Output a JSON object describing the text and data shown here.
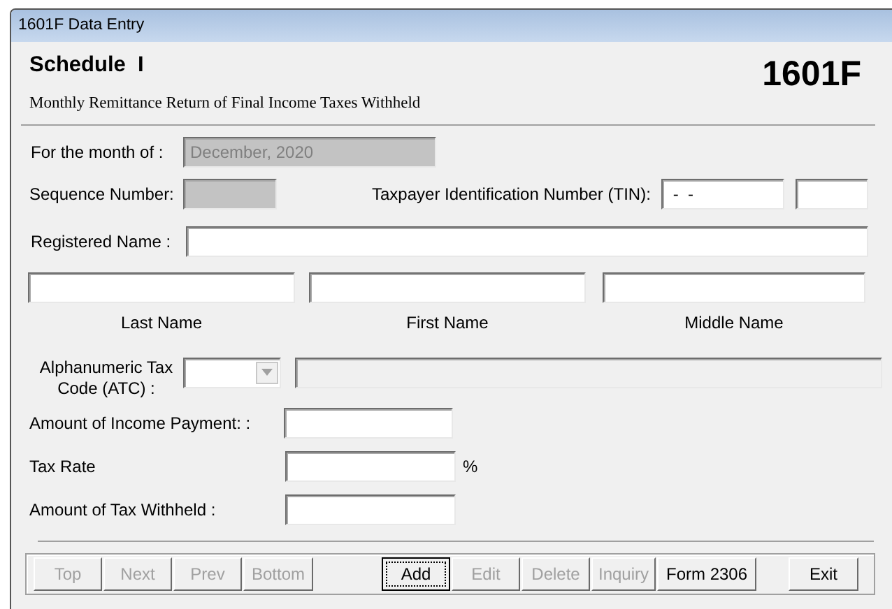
{
  "window": {
    "title": "1601F Data Entry"
  },
  "header": {
    "schedule": "Schedule  I",
    "form_number": "1601F",
    "subtitle": "Monthly Remittance Return of Final Income Taxes Withheld"
  },
  "month": {
    "label": "For the month of :",
    "value": "December, 2020",
    "disabled": true
  },
  "sequence": {
    "label": "Sequence Number:",
    "disabled": true
  },
  "tin": {
    "label": "Taxpayer Identification Number (TIN):",
    "value": " -  -",
    "disabled": false
  },
  "registered_name": {
    "label": "Registered Name :",
    "disabled": false
  },
  "name_fields": [
    {
      "label": "Last Name",
      "disabled": false
    },
    {
      "label": "First Name",
      "disabled": false
    },
    {
      "label": "Middle Name",
      "disabled": false
    }
  ],
  "atc": {
    "label": "Alphanumeric Tax Code (ATC) :",
    "disabled": false,
    "description_disabled": true
  },
  "amounts": [
    {
      "label": "Amount of Income Payment: :",
      "disabled": false
    },
    {
      "label": "Tax Rate",
      "unit": "%",
      "disabled": false
    },
    {
      "label": "Amount of Tax Withheld :",
      "disabled": false
    }
  ],
  "navigation_buttons": [
    {
      "label": "Top",
      "disabled": true,
      "focused": false
    },
    {
      "label": "Next",
      "disabled": true,
      "focused": false
    },
    {
      "label": "Prev",
      "disabled": true,
      "focused": false
    },
    {
      "label": "Bottom",
      "disabled": true,
      "focused": false
    }
  ],
  "record_buttons": [
    {
      "label": "Add",
      "disabled": false,
      "focused": true
    },
    {
      "label": "Edit",
      "disabled": true,
      "focused": false
    },
    {
      "label": "Delete",
      "disabled": true,
      "focused": false
    },
    {
      "label": "Inquiry",
      "disabled": true,
      "focused": false
    },
    {
      "label": "Form 2306",
      "disabled": false,
      "focused": false
    }
  ],
  "exit_button": {
    "label": "Exit",
    "disabled": false,
    "focused": false
  }
}
